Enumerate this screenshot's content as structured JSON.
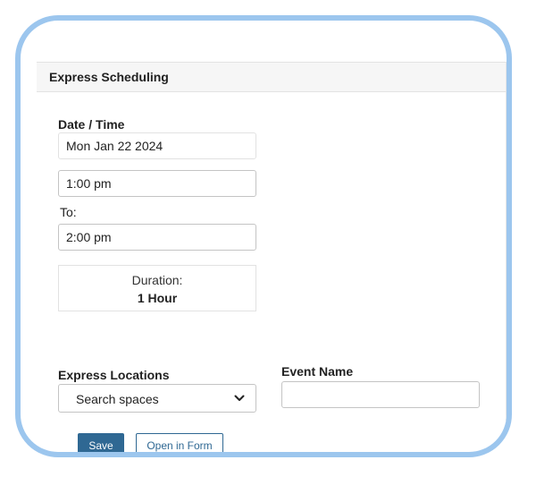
{
  "panel": {
    "title": "Express Scheduling"
  },
  "datetime": {
    "label": "Date / Time",
    "date_value": "Mon Jan 22 2024",
    "start_time": "1:00 pm",
    "to_label": "To:",
    "end_time": "2:00 pm"
  },
  "duration": {
    "label": "Duration:",
    "value": "1 Hour"
  },
  "locations": {
    "label": "Express Locations",
    "selected": "Search spaces"
  },
  "event_name": {
    "label": "Event Name",
    "value": ""
  },
  "actions": {
    "save_label": "Save",
    "open_form_label": "Open in Form"
  },
  "colors": {
    "frame_border": "#9cc6ee",
    "primary": "#2f6893"
  },
  "icons": {
    "dropdown": "chevron-down-icon"
  }
}
